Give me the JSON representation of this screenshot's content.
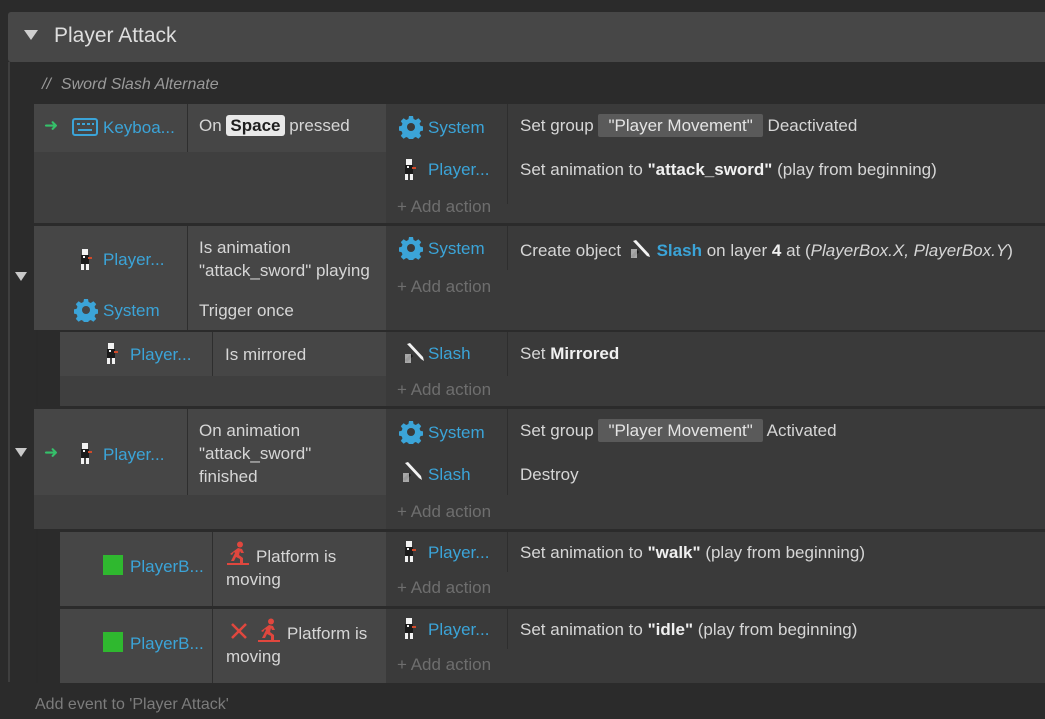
{
  "group": {
    "title": "Player Attack"
  },
  "comment": {
    "slashes": "//",
    "text": "Sword Slash Alternate"
  },
  "events": {
    "e1": {
      "cond_obj": "Keyboa...",
      "cond_text_pre": "On",
      "cond_key": "Space",
      "cond_text_post": "pressed",
      "a1_obj": "System",
      "a1_pre": "Set group",
      "a1_pill": "\"Player Movement\"",
      "a1_post": "Deactivated",
      "a2_obj": "Player...",
      "a2_pre": "Set animation to",
      "a2_bold": "\"attack_sword\"",
      "a2_post": "(play from beginning)"
    },
    "e2": {
      "c1_obj": "Player...",
      "c1_line1": "Is animation",
      "c1_line2": "\"attack_sword\" playing",
      "c2_obj": "System",
      "c2_text": "Trigger once",
      "a1_obj": "System",
      "a1_pre": "Create object",
      "a1_obj2": "Slash",
      "a1_mid": "on layer",
      "a1_layer": "4",
      "a1_at": "at (",
      "a1_coords": "PlayerBox.X, PlayerBox.Y",
      "a1_close": ")"
    },
    "e2_sub": {
      "c_obj": "Player...",
      "c_text": "Is mirrored",
      "a_obj": "Slash",
      "a_pre": "Set",
      "a_bold": "Mirrored"
    },
    "e3": {
      "c_obj": "Player...",
      "c_line1": "On animation",
      "c_line2": "\"attack_sword\"",
      "c_line3": "finished",
      "a1_obj": "System",
      "a1_pre": "Set group",
      "a1_pill": "\"Player Movement\"",
      "a1_post": "Activated",
      "a2_obj": "Slash",
      "a2_text": "Destroy"
    },
    "e3_sub1": {
      "c_obj": "PlayerB...",
      "c_line1": "Platform is",
      "c_line2": "moving",
      "a_obj": "Player...",
      "a_pre": "Set animation to",
      "a_bold": "\"walk\"",
      "a_post": "(play from beginning)"
    },
    "e3_sub2": {
      "c_obj": "PlayerB...",
      "c_line1": "Platform is",
      "c_line2": "moving",
      "a_obj": "Player...",
      "a_pre": "Set animation to",
      "a_bold": "\"idle\"",
      "a_post": "(play from beginning)"
    }
  },
  "add_action": "+ Add action",
  "footer": "Add event to 'Player Attack'",
  "colors": {
    "object_blue": "#3ba4d8",
    "trigger_green": "#35c06a",
    "invert_red": "#e0473e",
    "platform_green": "#2fb82f"
  },
  "icons": [
    "gear-icon",
    "keyboard-icon",
    "player-sprite-icon",
    "slash-sprite-icon",
    "platform-behavior-icon",
    "invert-x-icon",
    "trigger-arrow-icon",
    "collapse-triangle-icon"
  ]
}
